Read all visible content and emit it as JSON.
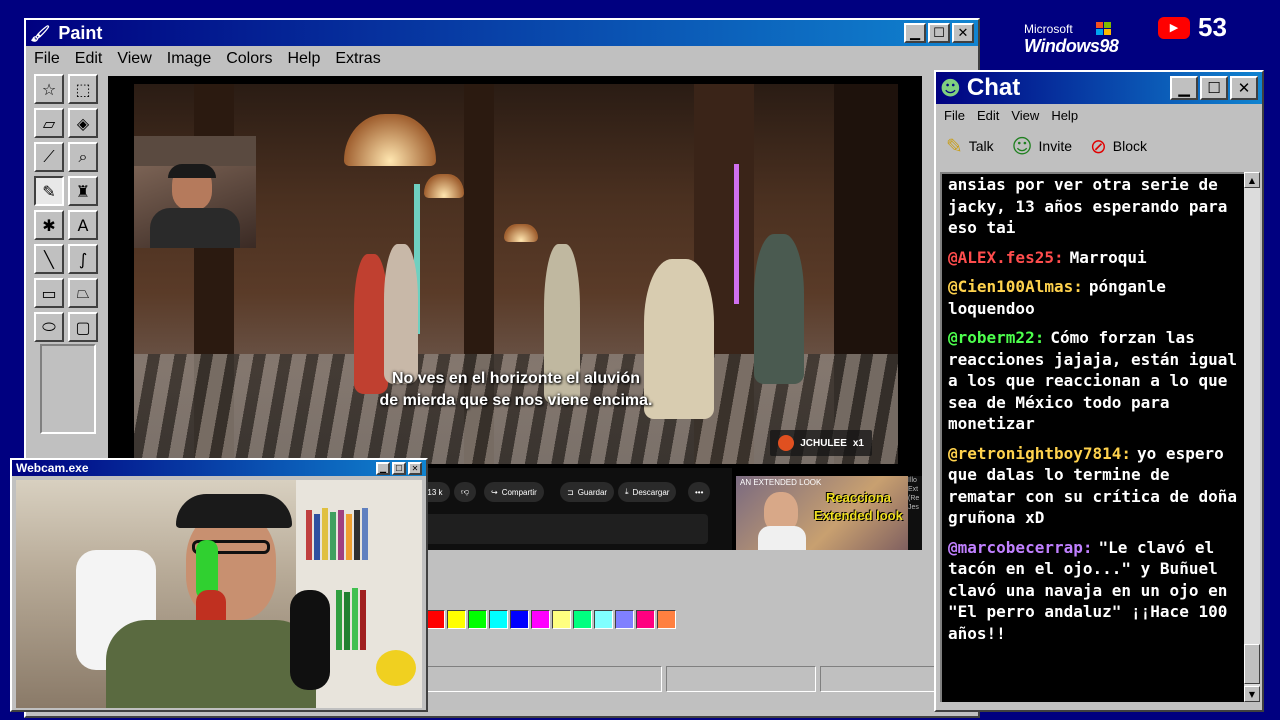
{
  "desktop": {
    "os_logo_top": "Microsoft",
    "os_logo_bottom": "Windows98",
    "youtube_count": "53",
    "youtube_icon": "youtube-play-icon"
  },
  "paint": {
    "title": "Paint",
    "menu": [
      "File",
      "Edit",
      "View",
      "Image",
      "Colors",
      "Help",
      "Extras"
    ],
    "tools": [
      {
        "name": "free-select-icon",
        "glyph": "☆"
      },
      {
        "name": "rect-select-icon",
        "glyph": "⬚"
      },
      {
        "name": "eraser-icon",
        "glyph": "▱"
      },
      {
        "name": "fill-bucket-icon",
        "glyph": "◈"
      },
      {
        "name": "color-picker-icon",
        "glyph": "⟋"
      },
      {
        "name": "magnifier-icon",
        "glyph": "⌕"
      },
      {
        "name": "pencil-icon",
        "glyph": "✎"
      },
      {
        "name": "brush-icon",
        "glyph": "♜"
      },
      {
        "name": "airbrush-icon",
        "glyph": "✱"
      },
      {
        "name": "text-icon",
        "glyph": "A"
      },
      {
        "name": "line-icon",
        "glyph": "╲"
      },
      {
        "name": "curve-icon",
        "glyph": "∫"
      },
      {
        "name": "rectangle-icon",
        "glyph": "▭"
      },
      {
        "name": "polygon-icon",
        "glyph": "⏢"
      },
      {
        "name": "ellipse-icon",
        "glyph": "⬭"
      },
      {
        "name": "rounded-rect-icon",
        "glyph": "▢"
      }
    ],
    "selected_tool": 6,
    "video": {
      "subtitle_line1": "No ves en el horizonte el aluvión",
      "subtitle_line2": "de mierda que se nos viene encima.",
      "watermark": "JCHULEE",
      "watermark_suffix": "x1"
    },
    "yt_actions": {
      "likes": "13 k",
      "share": "Compartir",
      "save": "Guardar",
      "download": "Descargar",
      "more": "•••"
    },
    "thumbnail": {
      "top_text": "AN EXTENDED LOOK",
      "line1": "Reacciona",
      "line2": "Extended look",
      "side_text": "Illo Ext (Re Jes"
    },
    "palette": [
      "#ff0000",
      "#ffff00",
      "#00ff00",
      "#00ffff",
      "#0000ff",
      "#ff00ff",
      "#ffff80",
      "#00ff80",
      "#80ffff",
      "#8080ff",
      "#ff0080",
      "#ff8040"
    ]
  },
  "chat": {
    "title": "Chat",
    "menu": [
      "File",
      "Edit",
      "View",
      "Help"
    ],
    "tools": [
      {
        "label": "Talk",
        "icon": "talk-icon"
      },
      {
        "label": "Invite",
        "icon": "invite-icon"
      },
      {
        "label": "Block",
        "icon": "block-icon"
      }
    ],
    "messages": [
      {
        "user": "",
        "color": "#ffffff",
        "text": "ansias por ver otra serie de jacky, 13 años esperando para eso tai"
      },
      {
        "user": "@ALEX.fes25:",
        "color": "#ff4d4d",
        "text": "Marroqui"
      },
      {
        "user": "@Cien100Almas:",
        "color": "#ffd24d",
        "text": "pónganle loquendoo"
      },
      {
        "user": "@roberm22:",
        "color": "#4dff4d",
        "text": "Cómo forzan las reacciones jajaja, están igual a los que reaccionan a lo que sea de México todo para monetizar"
      },
      {
        "user": "@retronightboy7814:",
        "color": "#ffd24d",
        "text": "yo espero que dalas lo termine de rematar con su crítica de doña gruñona xD"
      },
      {
        "user": "@marcobecerrap:",
        "color": "#c080ff",
        "text": "\"Le clavó el tacón en el ojo...\" y Buñuel clavó una navaja en un ojo en \"El perro andaluz\" ¡¡Hace 100 años!!"
      }
    ]
  },
  "webcam": {
    "title": "Webcam.exe"
  }
}
